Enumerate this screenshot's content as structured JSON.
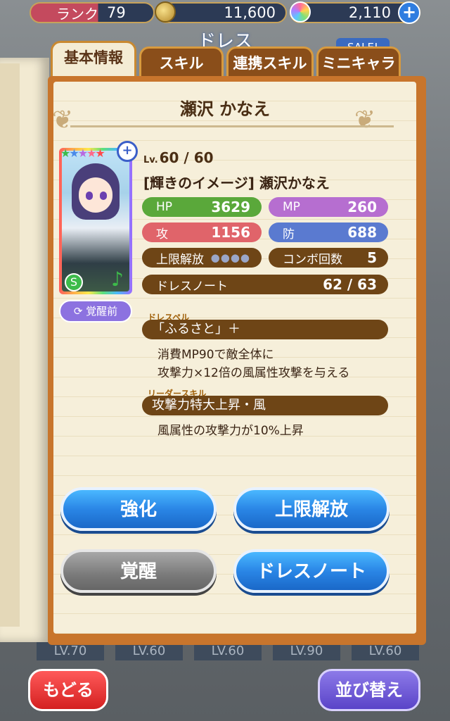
{
  "topbar": {
    "rank_label": "ランク",
    "rank_value": "79",
    "coins": "11,600",
    "gems": "2,110",
    "plus": "+"
  },
  "screen_title": "ドレス",
  "sale_badge": "SALE!",
  "tabs": [
    {
      "label": "基本情報",
      "active": true
    },
    {
      "label": "スキル",
      "active": false
    },
    {
      "label": "連携スキル",
      "active": false
    },
    {
      "label": "ミニキャラ",
      "active": false
    }
  ],
  "character": {
    "name": "瀬沢 かなえ",
    "level": "60 / 60",
    "level_prefix": "Lv.",
    "dress_title": "[輝きのイメージ] 瀬沢かなえ",
    "rarity_stars": 5,
    "awaken_state": "覚醒前",
    "attribute_icon": "wind-icon"
  },
  "stats": {
    "hp_label": "HP",
    "hp": "3629",
    "mp_label": "MP",
    "mp": "260",
    "atk_label": "攻",
    "atk": "1156",
    "def_label": "防",
    "def": "688",
    "limit_label": "上限解放",
    "limit_dots": "●●●●",
    "combo_label": "コンボ回数",
    "combo": "5",
    "dressnote_label": "ドレスノート",
    "dressnote": "62 / 63"
  },
  "dress_spell": {
    "tag": "ドレスペル",
    "name": "「ふるさと」＋",
    "desc1": "消費MP90で敵全体に",
    "desc2": "攻撃力×12倍の風属性攻撃を与える"
  },
  "leader_skill": {
    "tag": "リーダースキル",
    "name": "攻撃力特大上昇・風",
    "desc": "風属性の攻撃力が10%上昇"
  },
  "buttons": {
    "enhance": "強化",
    "limit_break": "上限解放",
    "awaken": "覚醒",
    "dress_note": "ドレスノート",
    "back": "もどる",
    "sort": "並び替え"
  },
  "bg_levels": [
    "LV.70",
    "LV.60",
    "LV.60",
    "LV.90",
    "LV.60"
  ],
  "colors": {
    "hp": "#5aa83a",
    "mp": "#b66ed0",
    "atk": "#e0646a",
    "def": "#5a7ad0",
    "panel": "#6e4516"
  }
}
